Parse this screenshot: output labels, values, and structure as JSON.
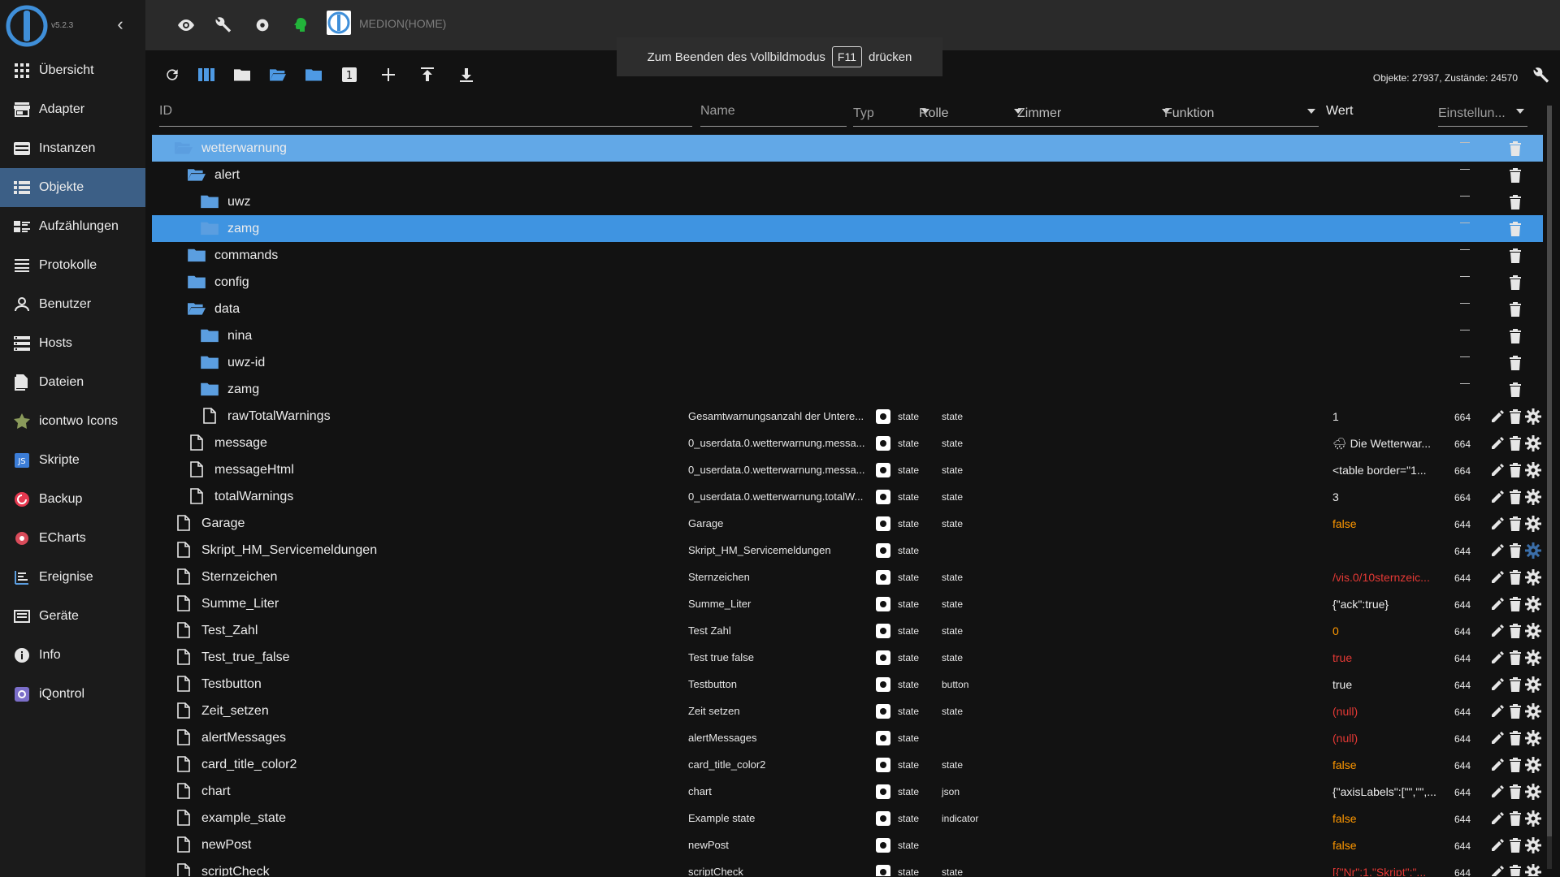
{
  "app": {
    "version": "v5.2.3",
    "host": "MEDION(HOME)"
  },
  "fullscreen_tip": {
    "before": "Zum Beenden des Vollbildmodus",
    "key": "F11",
    "after": "drücken"
  },
  "sidebar": {
    "items": [
      {
        "label": "Übersicht",
        "icon": "grid-icon"
      },
      {
        "label": "Adapter",
        "icon": "store-icon"
      },
      {
        "label": "Instanzen",
        "icon": "instances-icon"
      },
      {
        "label": "Objekte",
        "icon": "list-icon",
        "active": true
      },
      {
        "label": "Aufzählungen",
        "icon": "enum-icon"
      },
      {
        "label": "Protokolle",
        "icon": "log-icon"
      },
      {
        "label": "Benutzer",
        "icon": "user-icon"
      },
      {
        "label": "Hosts",
        "icon": "hosts-icon"
      },
      {
        "label": "Dateien",
        "icon": "files-icon"
      },
      {
        "label": "icontwo Icons",
        "icon": "icontwo-icon"
      },
      {
        "label": "Skripte",
        "icon": "scripts-icon"
      },
      {
        "label": "Backup",
        "icon": "backup-icon"
      },
      {
        "label": "ECharts",
        "icon": "echarts-icon"
      },
      {
        "label": "Ereignise",
        "icon": "events-icon"
      },
      {
        "label": "Geräte",
        "icon": "devices-icon"
      },
      {
        "label": "Info",
        "icon": "info-icon"
      },
      {
        "label": "iQontrol",
        "icon": "iqontrol-icon"
      }
    ]
  },
  "toolbar": {
    "stats": "Objekte: 27937, Zustände: 24570"
  },
  "columns": {
    "id": "ID",
    "name": "Name",
    "type": "Typ",
    "role": "Rolle",
    "room": "Zimmer",
    "function": "Funktion",
    "value": "Wert",
    "settings": "Einstellun..."
  },
  "colors": {
    "selected_row": "#62a8e7",
    "selected_row_active": "#3f94e1",
    "folder": "#5b9ee0",
    "value_orange": "#ff9800",
    "value_red": "#e53935",
    "sidebar_active": "#3c5f86"
  },
  "rows": [
    {
      "name": "wetterwarnung",
      "kind": "folder-open",
      "indent": 0,
      "sel": "sel"
    },
    {
      "name": "alert",
      "kind": "folder-open",
      "indent": 1
    },
    {
      "name": "uwz",
      "kind": "folder",
      "indent": 2
    },
    {
      "name": "zamg",
      "kind": "folder",
      "indent": 2,
      "sel": "sel2"
    },
    {
      "name": "commands",
      "kind": "folder",
      "indent": 1
    },
    {
      "name": "config",
      "kind": "folder",
      "indent": 1
    },
    {
      "name": "data",
      "kind": "folder-open",
      "indent": 1
    },
    {
      "name": "nina",
      "kind": "folder",
      "indent": 2
    },
    {
      "name": "uwz-id",
      "kind": "folder",
      "indent": 2
    },
    {
      "name": "zamg",
      "kind": "folder",
      "indent": 2
    },
    {
      "name": "rawTotalWarnings",
      "kind": "file",
      "indent": 2,
      "desc": "Gesamtwarnungsanzahl der Untere...",
      "type": "state",
      "role": "state",
      "value": "1",
      "vcolor": "white",
      "perm": "664"
    },
    {
      "name": "message",
      "kind": "file",
      "indent": 1,
      "desc": "0_userdata.0.wetterwarnung.messa...",
      "type": "state",
      "role": "state",
      "value": "🌧 Die Wetterwar...",
      "vcolor": "white",
      "perm": "664"
    },
    {
      "name": "messageHtml",
      "kind": "file",
      "indent": 1,
      "desc": "0_userdata.0.wetterwarnung.messa...",
      "type": "state",
      "role": "state",
      "value": "<table border=\"1...",
      "vcolor": "white",
      "perm": "664"
    },
    {
      "name": "totalWarnings",
      "kind": "file",
      "indent": 1,
      "desc": "0_userdata.0.wetterwarnung.totalW...",
      "type": "state",
      "role": "state",
      "value": "3",
      "vcolor": "white",
      "perm": "664"
    },
    {
      "name": "Garage",
      "kind": "file",
      "indent": 0,
      "desc": "Garage",
      "type": "state",
      "role": "state",
      "value": "false",
      "vcolor": "orange",
      "perm": "644"
    },
    {
      "name": "Skript_HM_Servicemeldungen",
      "kind": "file",
      "indent": 0,
      "desc": "Skript_HM_Servicemeldungen",
      "type": "state",
      "role": "",
      "value": "",
      "vcolor": "white",
      "perm": "644",
      "gearblue": true
    },
    {
      "name": "Sternzeichen",
      "kind": "file",
      "indent": 0,
      "desc": "Sternzeichen",
      "type": "state",
      "role": "state",
      "value": "/vis.0/10sternzeic...",
      "vcolor": "red",
      "perm": "644"
    },
    {
      "name": "Summe_Liter",
      "kind": "file",
      "indent": 0,
      "desc": "Summe_Liter",
      "type": "state",
      "role": "state",
      "value": "{\"ack\":true}",
      "vcolor": "white",
      "perm": "644"
    },
    {
      "name": "Test_Zahl",
      "kind": "file",
      "indent": 0,
      "desc": "Test Zahl",
      "type": "state",
      "role": "state",
      "value": "0",
      "vcolor": "orange",
      "perm": "644"
    },
    {
      "name": "Test_true_false",
      "kind": "file",
      "indent": 0,
      "desc": "Test true false",
      "type": "state",
      "role": "state",
      "value": "true",
      "vcolor": "red",
      "perm": "644"
    },
    {
      "name": "Testbutton",
      "kind": "file",
      "indent": 0,
      "desc": "Testbutton",
      "type": "state",
      "role": "button",
      "value": "true",
      "vcolor": "white",
      "perm": "644"
    },
    {
      "name": "Zeit_setzen",
      "kind": "file",
      "indent": 0,
      "desc": "Zeit setzen",
      "type": "state",
      "role": "state",
      "value": "(null)",
      "vcolor": "red",
      "perm": "644"
    },
    {
      "name": "alertMessages",
      "kind": "file",
      "indent": 0,
      "desc": "alertMessages",
      "type": "state",
      "role": "",
      "value": "(null)",
      "vcolor": "red",
      "perm": "644"
    },
    {
      "name": "card_title_color2",
      "kind": "file",
      "indent": 0,
      "desc": "card_title_color2",
      "type": "state",
      "role": "state",
      "value": "false",
      "vcolor": "orange",
      "perm": "644"
    },
    {
      "name": "chart",
      "kind": "file",
      "indent": 0,
      "desc": "chart",
      "type": "state",
      "role": "json",
      "value": "{\"axisLabels\":[\"\",\"\",...",
      "vcolor": "white",
      "perm": "644"
    },
    {
      "name": "example_state",
      "kind": "file",
      "indent": 0,
      "desc": "Example state",
      "type": "state",
      "role": "indicator",
      "value": "false",
      "vcolor": "orange",
      "perm": "644"
    },
    {
      "name": "newPost",
      "kind": "file",
      "indent": 0,
      "desc": "newPost",
      "type": "state",
      "role": "",
      "value": "false",
      "vcolor": "orange",
      "perm": "644"
    },
    {
      "name": "scriptCheck",
      "kind": "file",
      "indent": 0,
      "desc": "scriptCheck",
      "type": "state",
      "role": "state",
      "value": "[{\"Nr\":1,\"Skript\":\"...",
      "vcolor": "red",
      "perm": "644"
    }
  ]
}
